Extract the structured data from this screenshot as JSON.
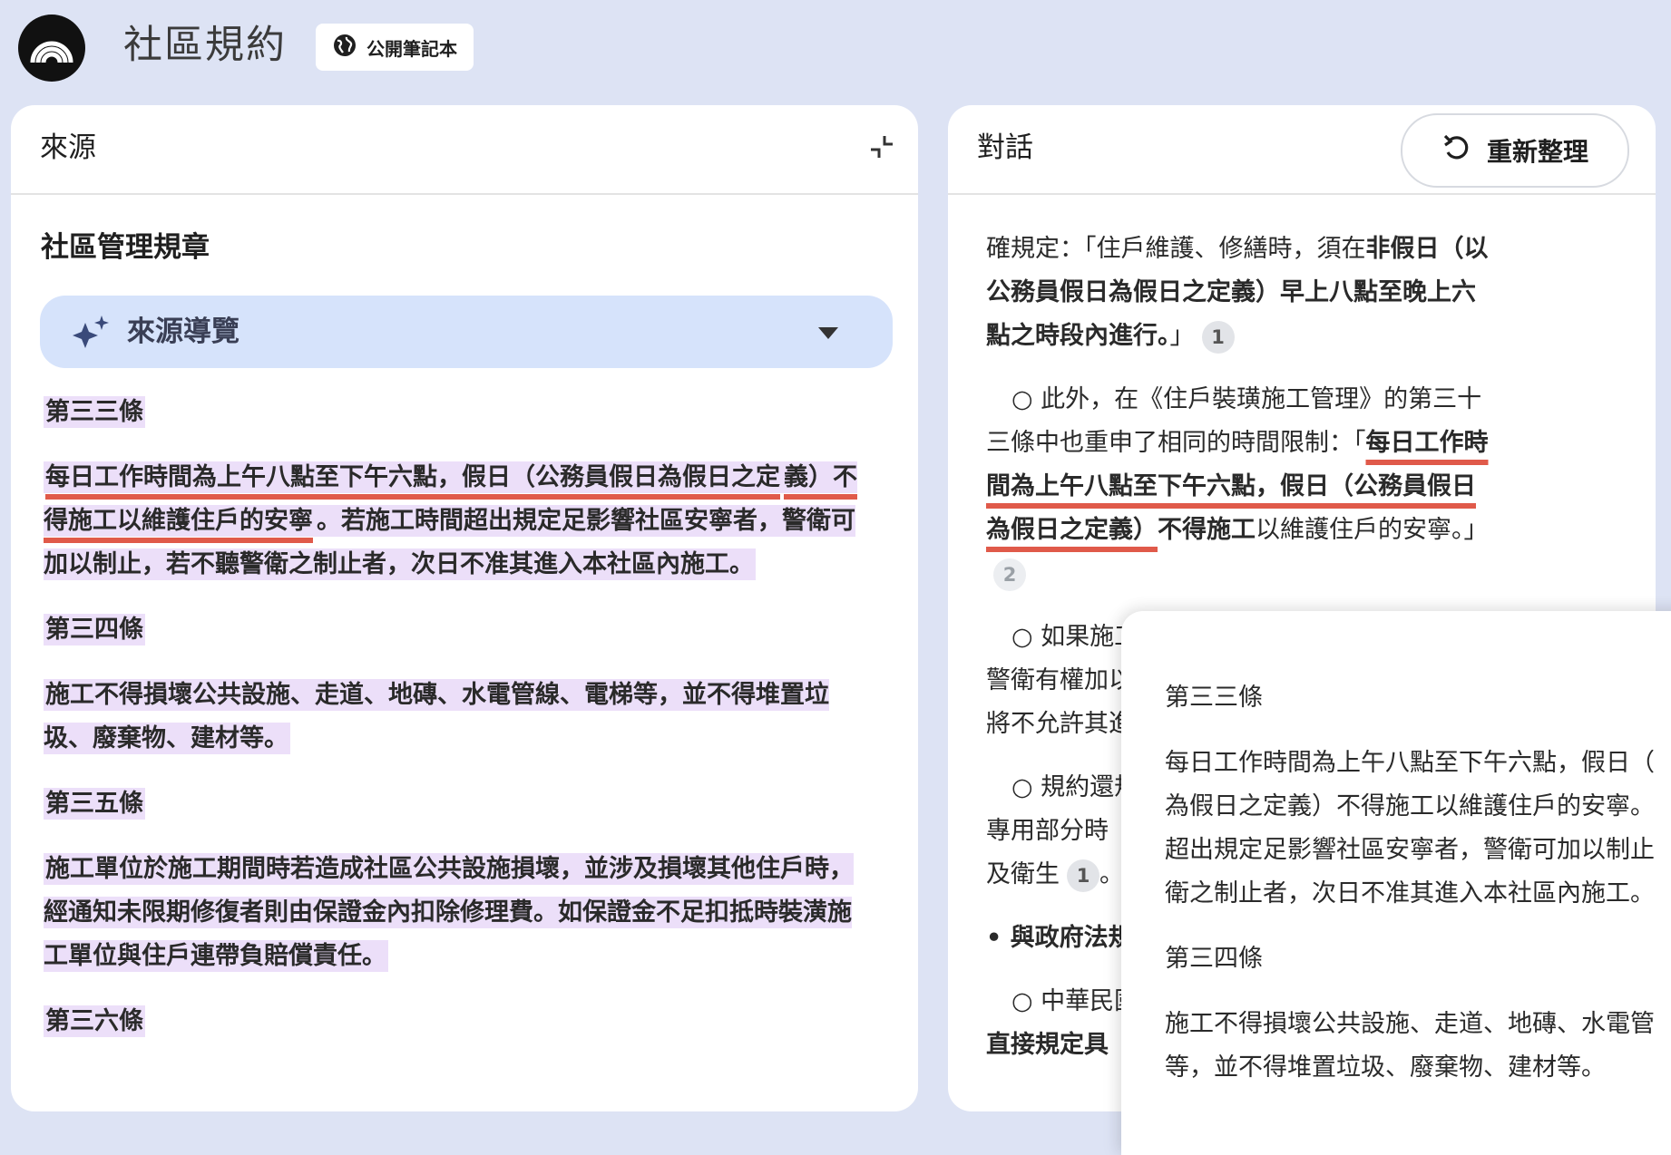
{
  "header": {
    "app_title": "社區規約",
    "public_chip_label": "公開筆記本"
  },
  "left_panel": {
    "title": "來源",
    "source_title": "社區管理規章",
    "source_guide_label": "來源導覽",
    "doc": {
      "art33_heading": "第三三條",
      "art33_text_underlined_1": "每日工作時間為上午八點至下午六點，假日（公務員假日為假日之定",
      "art33_text_underlined_2": "義）不得施工以維護住戶的安寧",
      "art33_text_rest": "。若施工時間超出規定足影響社區安寧者，警衛可加以制止，若不聽警衛之制止者，次日不准其進入本社區內施工。",
      "art34_heading": "第三四條",
      "art34_text": "施工不得損壞公共設施、走道、地磚、水電管線、電梯等，並不得堆置垃圾、廢棄物、建材等。",
      "art35_heading": "第三五條",
      "art35_text": "施工單位於施工期間時若造成社區公共設施損壞，並涉及損壞其他住戶時，經通知未限期修復者則由保證金內扣除修理費。如保證金不足扣抵時裝潢施工單位與住戶連帶負賠償責任。",
      "art36_heading": "第三六條"
    }
  },
  "right_panel": {
    "title": "對話",
    "refresh_label": "重新整理",
    "chat": {
      "p1_a": "確規定：「住戶維護、修繕時，須在",
      "p1_b": "非假日（以公務員假日為假日之定義）早上八點至晚上六點之時段內進行。",
      "p1_c": "」",
      "p1_cite": "1",
      "p2_a": "○ 此外，在《住戶裝璜施工管理》的第三十三條中也重申了相同的時間限制：「",
      "p2_b": "每日工作時間為上午八點至下午六點，假日（公務員假日為假日之定義）",
      "p2_c": "不得施工",
      "p2_d": "以維護住戶的安寧。」",
      "p2_cite": "2",
      "p3_a": "○ 如果施工",
      "p3_b": "警衛有權加以",
      "p3_c": "將不允許其進",
      "p4_a": "○ 規約還規",
      "p4_b": "專用部分時",
      "p4_c": "及衛生",
      "p4_cite": "1",
      "p4_d": "。",
      "p5": "• 與政府法規",
      "p6_a": "○ 中華民國",
      "p6_b": "直接規定具"
    }
  },
  "tooltip": {
    "art33_heading": "第三三條",
    "art33_line1": "每日工作時間為上午八點至下午六點，假日（",
    "art33_line2": "為假日之定義）不得施工以維護住戶的安寧。",
    "art33_line3": "超出規定足影響社區安寧者，警衛可加以制止",
    "art33_line4": "衛之制止者，次日不准其進入本社區內施工。",
    "art34_heading": "第三四條",
    "art34_line1": "施工不得損壞公共設施、走道、地磚、水電管",
    "art34_line2": "等，並不得堆置垃圾、廢棄物、建材等。"
  },
  "colors": {
    "background": "#dde3f4",
    "highlight": "#ecdff9",
    "underline": "#e05a4a",
    "guide_bar": "#d6e3fb"
  },
  "icons": {
    "logo": "notebook-logo-icon",
    "public": "globe-icon",
    "collapse": "collapse-icon",
    "refresh": "refresh-icon",
    "guide": "sparkle-icon",
    "dropdown": "caret-down-icon"
  }
}
